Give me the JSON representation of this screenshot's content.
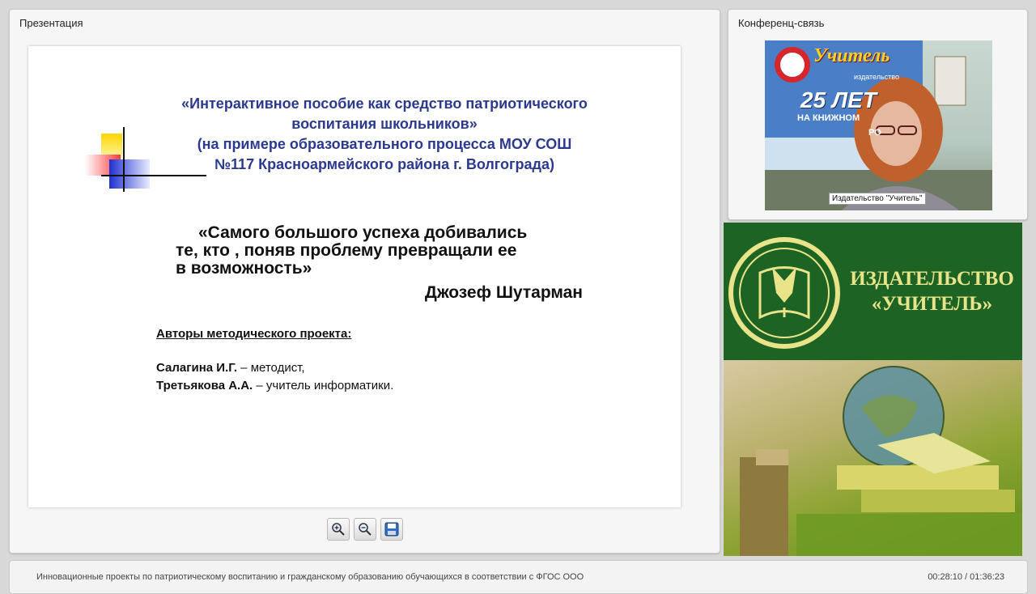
{
  "presentation": {
    "panel_title": "Презентация",
    "slide": {
      "title_lines": [
        "«Интерактивное пособие как средство патриотического",
        "воспитания школьников»",
        "(на примере образовательного процесса МОУ СОШ",
        "№117 Красноармейского района г. Волгограда)"
      ],
      "quote_lines": [
        "«Самого большого успеха добивались",
        "те, кто , поняв проблему превращали ее",
        "в возможность»"
      ],
      "quote_author": "Джозеф Шутарман",
      "authors_heading": "Авторы методического проекта:",
      "authors": [
        {
          "name": "Салагина И.Г.",
          "role": " – методист,"
        },
        {
          "name": "Третьякова А.А.",
          "role": " – учитель информатики."
        }
      ]
    },
    "toolbar": {
      "zoom_in_icon": "zoom-in-icon",
      "zoom_out_icon": "zoom-out-icon",
      "save_icon": "save-icon"
    }
  },
  "conference": {
    "panel_title": "Конференц-связь",
    "video_caption": "Издательство \"Учитель\"",
    "poster_text": [
      "Учитель",
      "издательство",
      "25 ЛЕТ",
      "НА КНИЖНОМ",
      "РО"
    ]
  },
  "brand": {
    "name_lines": [
      "ИЗДАТЕЛЬСТВО",
      "«УЧИТЕЛЬ»"
    ]
  },
  "status": {
    "title": "Инновационные проекты по патриотическому воспитанию и гражданскому образованию обучающихся в соответствии с ФГОС ООО",
    "time": "00:28:10 / 01:36:23"
  },
  "colors": {
    "slide_title": "#2b3990",
    "brand_green": "#1d6324",
    "brand_text": "#e9e48a"
  }
}
